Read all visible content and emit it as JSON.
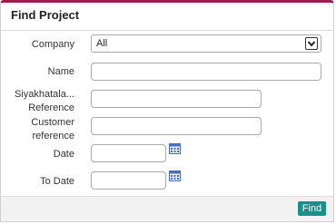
{
  "panel": {
    "title": "Find Project"
  },
  "fields": {
    "company": {
      "label": "Company",
      "value": "All"
    },
    "name": {
      "label": "Name",
      "value": ""
    },
    "reference": {
      "label_line1": "Siyakhatala...",
      "label_line2": "Reference",
      "value": ""
    },
    "customer_reference": {
      "label_line1": "Customer",
      "label_line2": "reference",
      "value": ""
    },
    "date": {
      "label": "Date",
      "value": ""
    },
    "to_date": {
      "label": "To Date",
      "value": ""
    }
  },
  "footer": {
    "find_label": "Find"
  },
  "icons": {
    "calendar": "calendar-icon",
    "dropdown": "chevron-down-icon"
  },
  "colors": {
    "accent_top": "#a01c4a",
    "button": "#1b8f8a"
  }
}
